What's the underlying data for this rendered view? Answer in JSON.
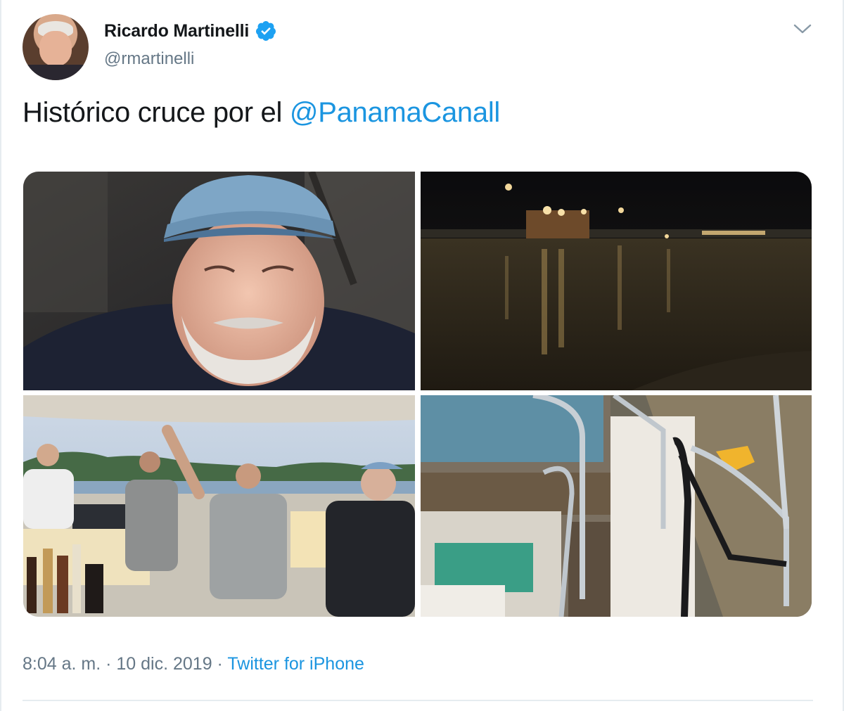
{
  "tweet": {
    "author": {
      "display_name": "Ricardo Martinelli",
      "handle": "@rmartinelli",
      "verified": true,
      "avatar_icon": "profile-photo"
    },
    "text": {
      "plain": "Histórico cruce por el ",
      "mention": "@PanamaCanall"
    },
    "media": [
      {
        "name": "selfie-photo",
        "description_icon": "photo"
      },
      {
        "name": "night-canal-photo",
        "description_icon": "photo"
      },
      {
        "name": "yacht-deck-group-photo",
        "description_icon": "photo"
      },
      {
        "name": "yacht-rail-photo",
        "description_icon": "photo"
      }
    ],
    "meta": {
      "time": "8:04 a. m.",
      "separator1": " · ",
      "date": "10 dic. 2019",
      "separator2": " · ",
      "source": "Twitter for iPhone"
    },
    "colors": {
      "link": "#1b95e0",
      "secondary": "#657786",
      "primary": "#14171a",
      "verified": "#1da1f2"
    }
  }
}
